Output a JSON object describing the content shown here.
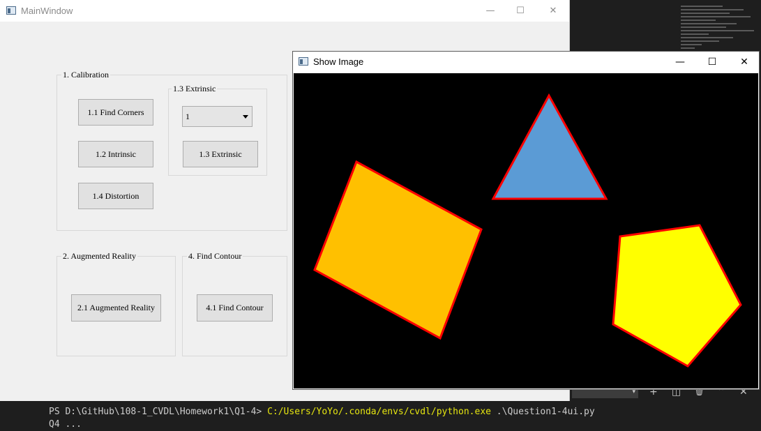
{
  "main_window": {
    "title": "MainWindow",
    "minimize": "—",
    "maximize": "☐",
    "close": "✕",
    "calibration": {
      "title": "1. Calibration",
      "find_corners": "1.1 Find Corners",
      "intrinsic": "1.2 Intrinsic",
      "distortion": "1.4 Distortion",
      "extrinsic_group": {
        "title": "1.3 Extrinsic",
        "combo_value": "1",
        "button": "1.3 Extrinsic"
      }
    },
    "augmented_reality": {
      "title": "2. Augmented Reality",
      "button": "2.1 Augmented Reality"
    },
    "find_contour": {
      "title": "4. Find Contour",
      "button": "4.1 Find Contour"
    }
  },
  "show_window": {
    "title": "Show Image",
    "minimize": "—",
    "maximize": "☐",
    "close": "✕",
    "shapes": [
      {
        "name": "triangle",
        "fill": "#5b9bd5",
        "stroke": "#ff0000"
      },
      {
        "name": "rectangle",
        "fill": "#ffc000",
        "stroke": "#ff0000"
      },
      {
        "name": "pentagon",
        "fill": "#ffff00",
        "stroke": "#ff0000"
      }
    ]
  },
  "terminal": {
    "prompt": "PS D:\\GitHub\\108-1_CVDL\\Homework1\\Q1-4> ",
    "exe": "C:/Users/YoYo/.conda/envs/cvdl/python.exe",
    "args": " .\\Question1-4ui.py",
    "output": "Q4 ...",
    "select_arrow": "▾",
    "add_icon": "+",
    "split_icon": "◫",
    "trash_icon": "🗑",
    "up_icon": "⌃",
    "close_icon": "✕"
  }
}
